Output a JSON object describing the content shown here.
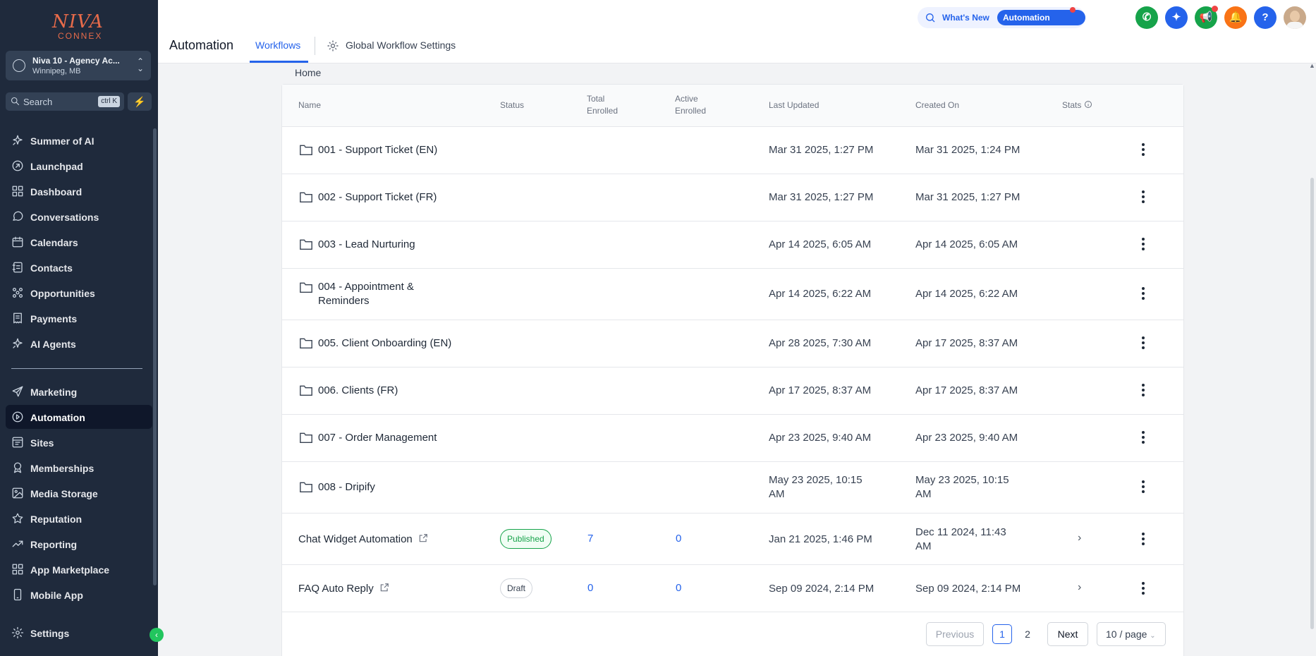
{
  "logo": {
    "brand": "NIVA",
    "sub": "CONNEX"
  },
  "account": {
    "name": "Niva 10 - Agency Ac...",
    "location": "Winnipeg, MB"
  },
  "search": {
    "placeholder": "Search",
    "shortcut": "ctrl K"
  },
  "sidebar": {
    "items": [
      {
        "label": "Summer of AI",
        "icon": "sparkle-icon"
      },
      {
        "label": "Launchpad",
        "icon": "rocket-icon"
      },
      {
        "label": "Dashboard",
        "icon": "grid-icon"
      },
      {
        "label": "Conversations",
        "icon": "chat-icon"
      },
      {
        "label": "Calendars",
        "icon": "calendar-icon"
      },
      {
        "label": "Contacts",
        "icon": "contacts-icon"
      },
      {
        "label": "Opportunities",
        "icon": "opportunities-icon"
      },
      {
        "label": "Payments",
        "icon": "receipt-icon"
      },
      {
        "label": "AI Agents",
        "icon": "sparkle-icon"
      },
      {
        "label": "Marketing",
        "icon": "send-icon"
      },
      {
        "label": "Automation",
        "icon": "automation-icon",
        "active": true
      },
      {
        "label": "Sites",
        "icon": "sites-icon"
      },
      {
        "label": "Memberships",
        "icon": "award-icon"
      },
      {
        "label": "Media Storage",
        "icon": "image-icon"
      },
      {
        "label": "Reputation",
        "icon": "star-icon"
      },
      {
        "label": "Reporting",
        "icon": "trend-icon"
      },
      {
        "label": "App Marketplace",
        "icon": "apps-icon"
      },
      {
        "label": "Mobile App",
        "icon": "phone-icon"
      }
    ],
    "settings_label": "Settings"
  },
  "header": {
    "title": "Automation",
    "tab_workflows": "Workflows",
    "tab_global": "Global Workflow Settings",
    "whats_new": "What's New",
    "automation_updates": "Automation Updates"
  },
  "breadcrumb": "Home",
  "table": {
    "headers": {
      "name": "Name",
      "status": "Status",
      "total_1": "Total",
      "total_2": "Enrolled",
      "active_1": "Active",
      "active_2": "Enrolled",
      "last_updated": "Last Updated",
      "created_on": "Created On",
      "stats": "Stats"
    },
    "rows": [
      {
        "name": "001 - Support Ticket (EN)",
        "type": "folder",
        "updated": "Mar 31 2025, 1:27 PM",
        "created": "Mar 31 2025, 1:24 PM"
      },
      {
        "name": "002 - Support Ticket (FR)",
        "type": "folder",
        "updated": "Mar 31 2025, 1:27 PM",
        "created": "Mar 31 2025, 1:27 PM"
      },
      {
        "name": "003 - Lead Nurturing",
        "type": "folder",
        "updated": "Apr 14 2025, 6:05 AM",
        "created": "Apr 14 2025, 6:05 AM"
      },
      {
        "name_1": "004 - Appointment &",
        "name_2": "Reminders",
        "type": "folder",
        "updated": "Apr 14 2025, 6:22 AM",
        "created": "Apr 14 2025, 6:22 AM"
      },
      {
        "name": "005. Client Onboarding (EN)",
        "type": "folder",
        "updated": "Apr 28 2025, 7:30 AM",
        "created": "Apr 17 2025, 8:37 AM"
      },
      {
        "name": "006. Clients (FR)",
        "type": "folder",
        "updated": "Apr 17 2025, 8:37 AM",
        "created": "Apr 17 2025, 8:37 AM"
      },
      {
        "name": "007 - Order Management",
        "type": "folder",
        "updated": "Apr 23 2025, 9:40 AM",
        "created": "Apr 23 2025, 9:40 AM"
      },
      {
        "name": "008 - Dripify",
        "type": "folder",
        "updated_1": "May 23 2025, 10:15",
        "updated_2": "AM",
        "created_1": "May 23 2025, 10:15",
        "created_2": "AM"
      },
      {
        "name": "Chat Widget Automation",
        "type": "workflow",
        "status": "Published",
        "total": "7",
        "active": "0",
        "updated": "Jan 21 2025, 1:46 PM",
        "created_1": "Dec 11 2024, 11:43",
        "created_2": "AM"
      },
      {
        "name": "FAQ Auto Reply",
        "type": "workflow",
        "status": "Draft",
        "total": "0",
        "active": "0",
        "updated": "Sep 09 2024, 2:14 PM",
        "created": "Sep 09 2024, 2:14 PM"
      }
    ]
  },
  "pagination": {
    "previous": "Previous",
    "page_1": "1",
    "page_2": "2",
    "next": "Next",
    "page_size": "10 / page"
  },
  "colors": {
    "accent": "#2563eb",
    "sidebar_bg": "#1f2a3c",
    "published": "#16a34a"
  }
}
